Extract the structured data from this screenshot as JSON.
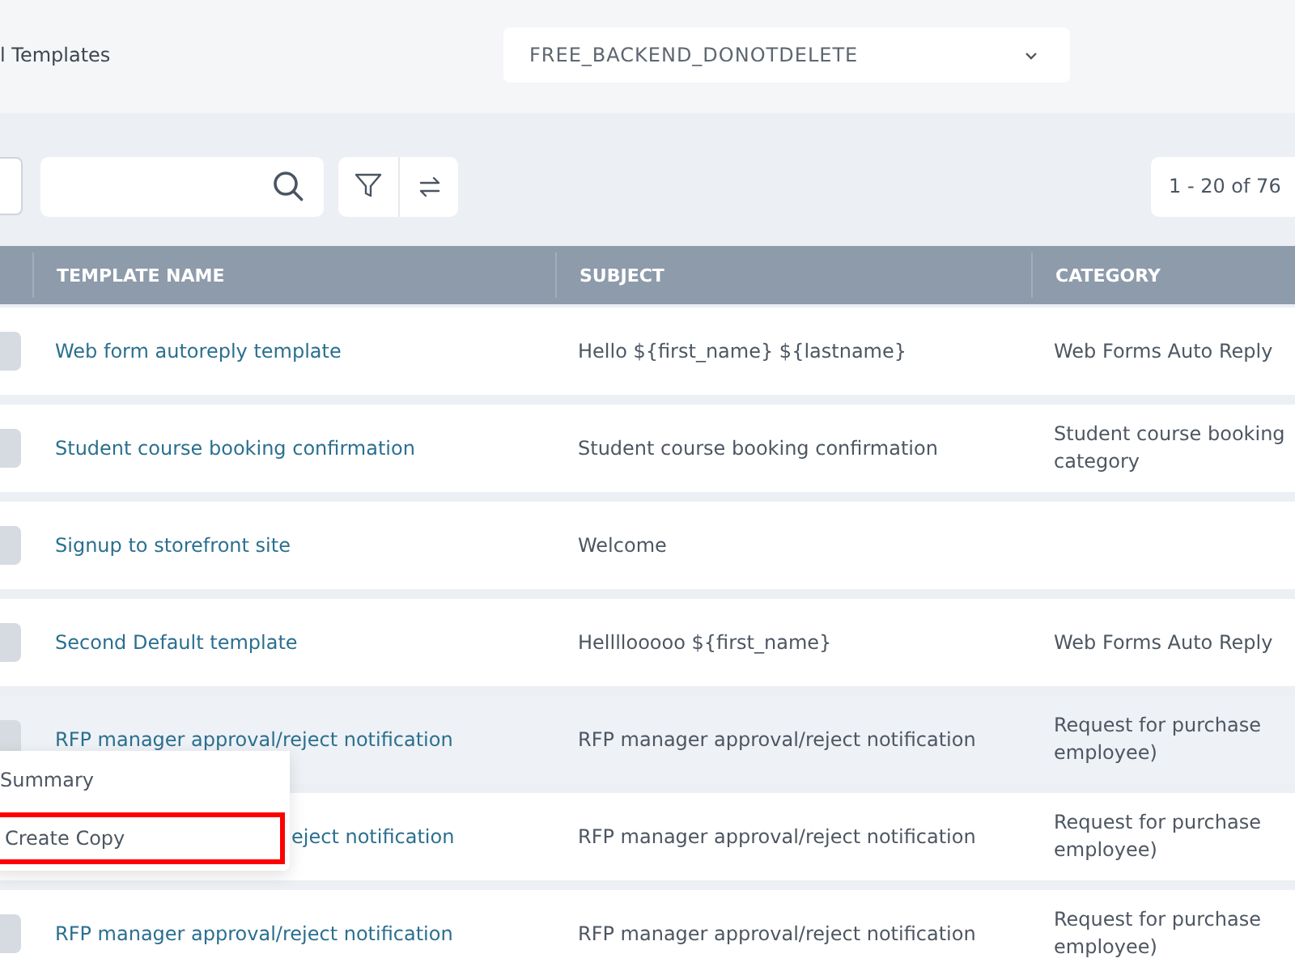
{
  "page_title": "l Templates",
  "account_select": {
    "value": "FREE_BACKEND_DONOTDELETE"
  },
  "pager": "1 - 20 of 76",
  "columns": [
    "TEMPLATE NAME",
    "SUBJECT",
    "CATEGORY"
  ],
  "rows": [
    {
      "name": "Web form autoreply template",
      "subject": "Hello ${first_name} ${lastname}",
      "category": [
        "Web Forms Auto Reply"
      ],
      "hovered": false,
      "covered": false
    },
    {
      "name": "Student course booking confirmation",
      "subject": "Student course booking confirmation",
      "category": [
        "Student course booking",
        "category"
      ],
      "hovered": false,
      "covered": false
    },
    {
      "name": "Signup to storefront site",
      "subject": "Welcome",
      "category": [],
      "hovered": false,
      "covered": false
    },
    {
      "name": "Second Default template",
      "subject": "Hellllooooo ${first_name}",
      "category": [
        "Web Forms Auto Reply"
      ],
      "hovered": false,
      "covered": false
    },
    {
      "name": "RFP manager approval/reject notification",
      "subject": "RFP manager approval/reject notification",
      "category": [
        "Request for purchase",
        "employee)"
      ],
      "hovered": true,
      "covered": false
    },
    {
      "name": "eject notification",
      "subject": "RFP manager approval/reject notification",
      "category": [
        "Request for purchase",
        "employee)"
      ],
      "hovered": false,
      "covered": true
    },
    {
      "name": "RFP manager approval/reject notification",
      "subject": "RFP manager approval/reject notification",
      "category": [
        "Request for purchase",
        "employee)"
      ],
      "hovered": false,
      "covered": false
    }
  ],
  "context_menu": [
    {
      "label": "Summary",
      "highlighted": false
    },
    {
      "label": "Create Copy",
      "highlighted": true
    }
  ]
}
